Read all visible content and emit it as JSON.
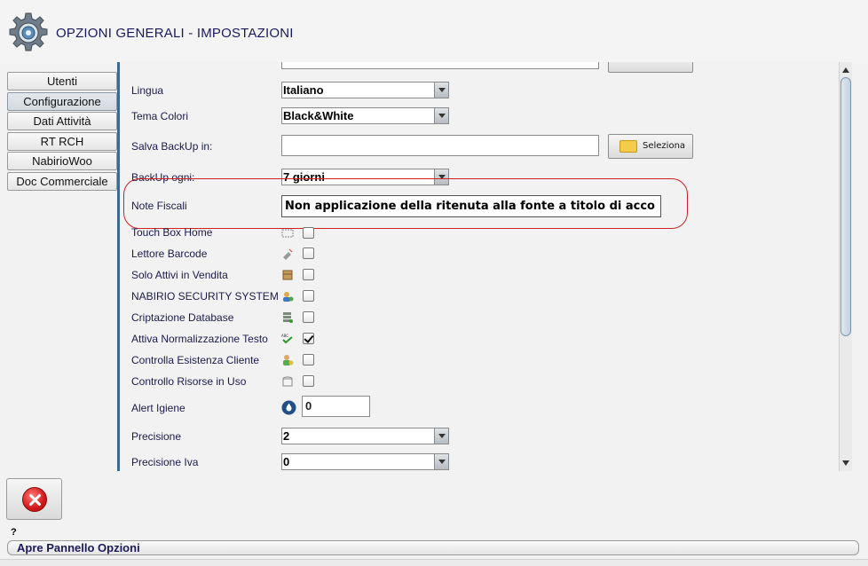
{
  "window": {
    "title": "OPZIONI GENERALI - IMPOSTAZIONI",
    "logo_icon": "gear-settings-icon"
  },
  "tabs": [
    {
      "label": "Utenti",
      "active": false
    },
    {
      "label": "Configurazione",
      "active": true
    },
    {
      "label": "Dati Attività",
      "active": false
    },
    {
      "label": "RT RCH",
      "active": false
    },
    {
      "label": "NabirioWoo",
      "active": false
    },
    {
      "label": "Doc Commerciale",
      "active": false
    }
  ],
  "form": {
    "lingua": {
      "label": "Lingua",
      "value": "Italiano"
    },
    "tema_colori": {
      "label": "Tema Colori",
      "value": "Black&White"
    },
    "salva_backup": {
      "label": "Salva BackUp in:",
      "value": "",
      "button": "Seleziona"
    },
    "backup_ogni": {
      "label": "BackUp ogni:",
      "value": "7 giorni"
    },
    "note_fiscali": {
      "label": "Note Fiscali",
      "value": "Non applicazione della ritenuta alla fonte a titolo di acco"
    },
    "touch_box_home": {
      "label": "Touch Box Home",
      "checked": false
    },
    "lettore_barcode": {
      "label": "Lettore Barcode",
      "checked": false
    },
    "solo_attivi": {
      "label": "Solo Attivi in Vendita",
      "checked": false
    },
    "security_system": {
      "label": "NABIRIO SECURITY SYSTEM",
      "checked": false
    },
    "criptazione": {
      "label": "Criptazione Database",
      "checked": false
    },
    "normalizzazione": {
      "label": "Attiva Normalizzazione Testo",
      "checked": true
    },
    "esistenza_cliente": {
      "label": "Controlla Esistenza Cliente",
      "checked": false
    },
    "risorse_uso": {
      "label": "Controllo Risorse in Uso",
      "checked": false
    },
    "alert_igiene": {
      "label": "Alert Igiene",
      "value": "0"
    },
    "precisione": {
      "label": "Precisione",
      "value": "2"
    },
    "precisione_iva": {
      "label": "Precisione Iva",
      "value": "0"
    }
  },
  "help_mark": "?",
  "status": {
    "text": "Apre Pannello Opzioni"
  },
  "colors": {
    "title": "#1a1a5a",
    "highlight": "#d02020",
    "accent": "#3d6a91"
  }
}
